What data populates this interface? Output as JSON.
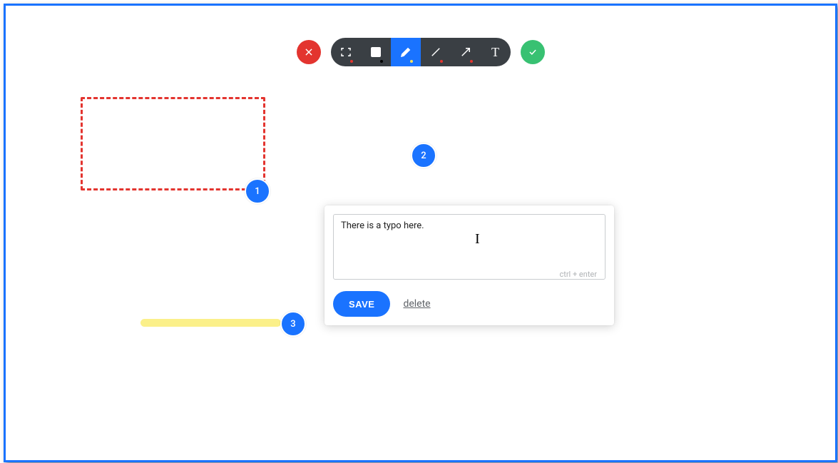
{
  "toolbar": {
    "tools": [
      {
        "name": "select",
        "dot_color": "#e3342f"
      },
      {
        "name": "rectangle",
        "dot_color": "#000000"
      },
      {
        "name": "pencil",
        "dot_color": "#f6e05e",
        "selected": true
      },
      {
        "name": "line",
        "dot_color": "#e3342f"
      },
      {
        "name": "arrow",
        "dot_color": "#e3342f"
      },
      {
        "name": "text",
        "dot_color": null
      }
    ]
  },
  "pins": {
    "p1": "1",
    "p2": "2",
    "p3": "3"
  },
  "comment": {
    "text": "There is a typo here.",
    "hint": "ctrl + enter",
    "save_label": "SAVE",
    "delete_label": "delete"
  },
  "colors": {
    "accent": "#1a73ff",
    "danger": "#e3342f",
    "success": "#38c172",
    "highlight": "#fbf08a"
  }
}
